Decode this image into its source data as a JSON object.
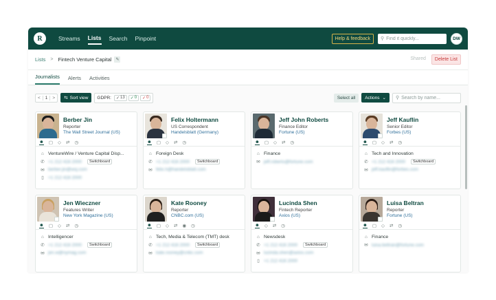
{
  "nav": {
    "logo": "R",
    "items": [
      "Streams",
      "Lists",
      "Search",
      "Pinpoint"
    ],
    "active": "Lists",
    "help": "Help & feedback",
    "search_placeholder": "Find it quickly...",
    "avatar": "DW"
  },
  "breadcrumb": {
    "root": "Lists",
    "separator": ">",
    "current": "Fintech Venture Capital",
    "shared": "Shared",
    "delete": "Delete List"
  },
  "tabs": [
    "Journalists",
    "Alerts",
    "Activities"
  ],
  "toolbar": {
    "page": "1",
    "prev": "<",
    "next": ">",
    "sort_view": "Sort view",
    "gdpr_label": "GDPR:",
    "gdpr_all": "13",
    "gdpr_ok": "0",
    "gdpr_no": "0",
    "select_all": "Select all",
    "actions": "Actions",
    "search_placeholder": "Search by name..."
  },
  "cards": [
    {
      "name": "Berber Jin",
      "role": "Reporter",
      "outlet": "The Wall Street Journal (US)",
      "desk": "VentureWire / Venture Capital Disp...",
      "phone": "+1 212 416 2000",
      "switchboard": "Switchboard",
      "email": "berber.jin@wsj.com",
      "mobile": "+1 212 416 2000"
    },
    {
      "name": "Felix Holtermann",
      "role": "US Correspondent",
      "outlet": "Handelsblatt (Germany)",
      "desk": "Foreign Desk",
      "phone": "+1 212 416 2000",
      "switchboard": "Switchboard",
      "email": "felix.h@handelsblatt.com",
      "mobile": ""
    },
    {
      "name": "Jeff John Roberts",
      "role": "Finance Editor",
      "outlet": "Fortune (US)",
      "desk": "Finance",
      "phone": "",
      "switchboard": "",
      "email": "jeff.roberts@fortune.com",
      "mobile": ""
    },
    {
      "name": "Jeff Kauflin",
      "role": "Senior Editor",
      "outlet": "Forbes (US)",
      "desk": "Tech and Innovation",
      "phone": "+1 212 416 2000",
      "switchboard": "Switchboard",
      "email": "jeff.kauflin@forbes.com",
      "mobile": ""
    },
    {
      "name": "Jen Wieczner",
      "role": "Features Writer",
      "outlet": "New York Magazine (US)",
      "desk": "Intelligencer",
      "phone": "+1 212 416 2000",
      "switchboard": "Switchboard",
      "email": "jen.w@nymag.com",
      "mobile": ""
    },
    {
      "name": "Kate Rooney",
      "role": "Reporter",
      "outlet": "CNBC.com (US)",
      "desk": "Tech, Media & Telecom (TMT) desk",
      "phone": "+1 212 416 2000",
      "switchboard": "Switchboard",
      "email": "kate.rooney@cnbc.com",
      "mobile": ""
    },
    {
      "name": "Lucinda Shen",
      "role": "Fintech Reporter",
      "outlet": "Axios (US)",
      "desk": "Newsdesk",
      "phone": "+1 212 416 2000",
      "switchboard": "Switchboard",
      "email": "lucinda.shen@axios.com",
      "mobile": "+1 212 416 2000"
    },
    {
      "name": "Luisa Beltran",
      "role": "Reporter",
      "outlet": "Fortune (US)",
      "desk": "Finance",
      "phone": "",
      "switchboard": "",
      "email": "luisa.beltran@fortune.com",
      "mobile": ""
    }
  ],
  "colors": {
    "brand": "#0f4a40",
    "accent_link": "#2f6f9a",
    "danger": "#c73a3a"
  }
}
